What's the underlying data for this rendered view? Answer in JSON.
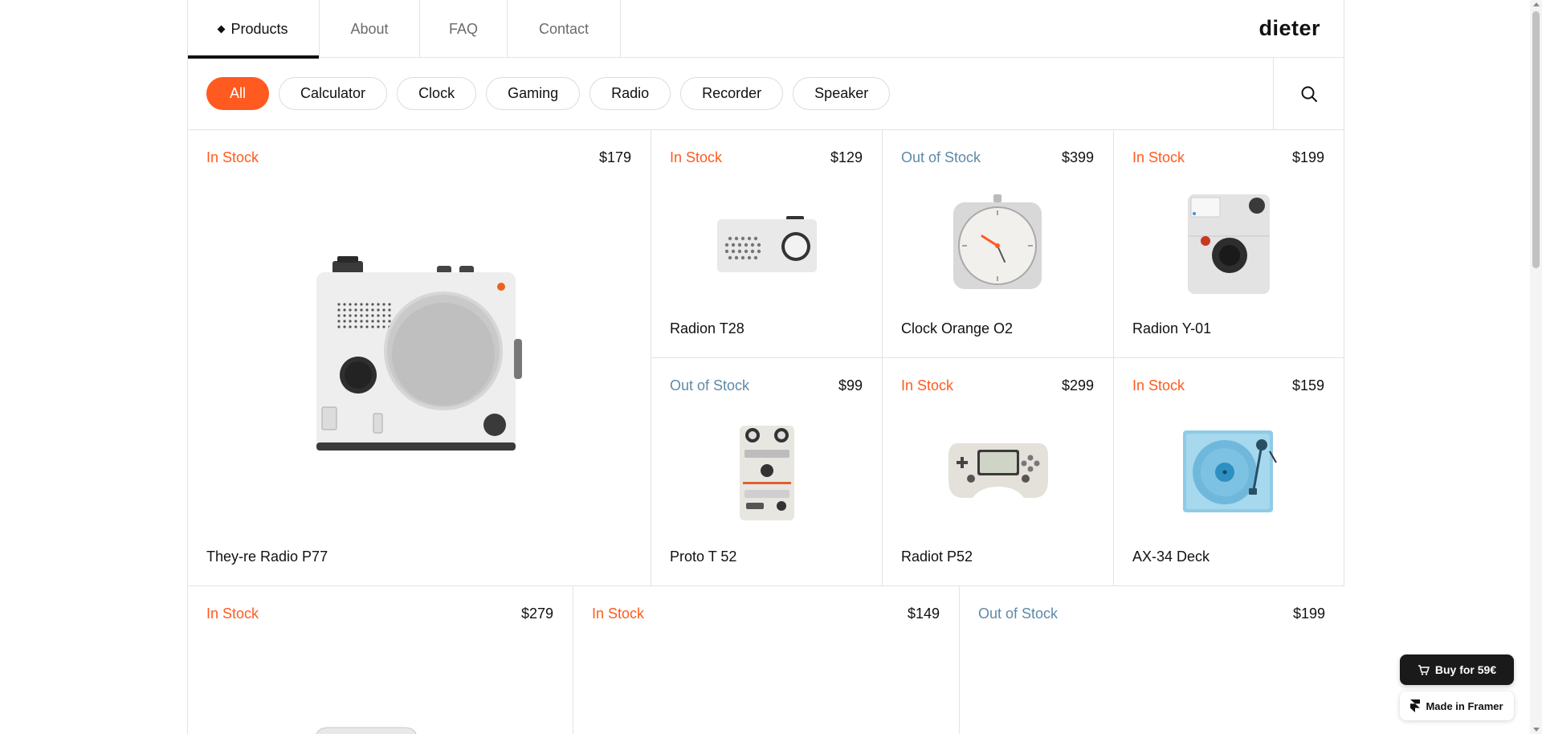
{
  "nav": {
    "tabs": [
      {
        "label": "Products",
        "active": true
      },
      {
        "label": "About",
        "active": false
      },
      {
        "label": "FAQ",
        "active": false
      },
      {
        "label": "Contact",
        "active": false
      }
    ],
    "logo": "dieter"
  },
  "filters": {
    "pills": [
      "All",
      "Calculator",
      "Clock",
      "Gaming",
      "Radio",
      "Recorder",
      "Speaker"
    ],
    "active": "All",
    "search_icon": "search-icon"
  },
  "products": [
    {
      "stock": "In Stock",
      "price": "$179",
      "name": "They-re Radio P77"
    },
    {
      "stock": "In Stock",
      "price": "$129",
      "name": "Radion T28"
    },
    {
      "stock": "Out of Stock",
      "price": "$399",
      "name": "Clock Orange O2"
    },
    {
      "stock": "In Stock",
      "price": "$199",
      "name": "Radion Y-01"
    },
    {
      "stock": "Out of Stock",
      "price": "$99",
      "name": "Proto T 52"
    },
    {
      "stock": "In Stock",
      "price": "$299",
      "name": "Radiot P52"
    },
    {
      "stock": "In Stock",
      "price": "$159",
      "name": "AX-34 Deck"
    },
    {
      "stock": "In Stock",
      "price": "$279",
      "name": ""
    },
    {
      "stock": "In Stock",
      "price": "$149",
      "name": ""
    },
    {
      "stock": "Out of Stock",
      "price": "$199",
      "name": ""
    }
  ],
  "colors": {
    "accent": "#ff5a1f",
    "out_of_stock": "#5d8aa8",
    "border": "#e3e3e3"
  },
  "floating": {
    "buy_label": "Buy for 59€",
    "buy_icon": "cart-icon",
    "framer_label": "Made in Framer",
    "framer_icon": "framer-logo-icon"
  }
}
